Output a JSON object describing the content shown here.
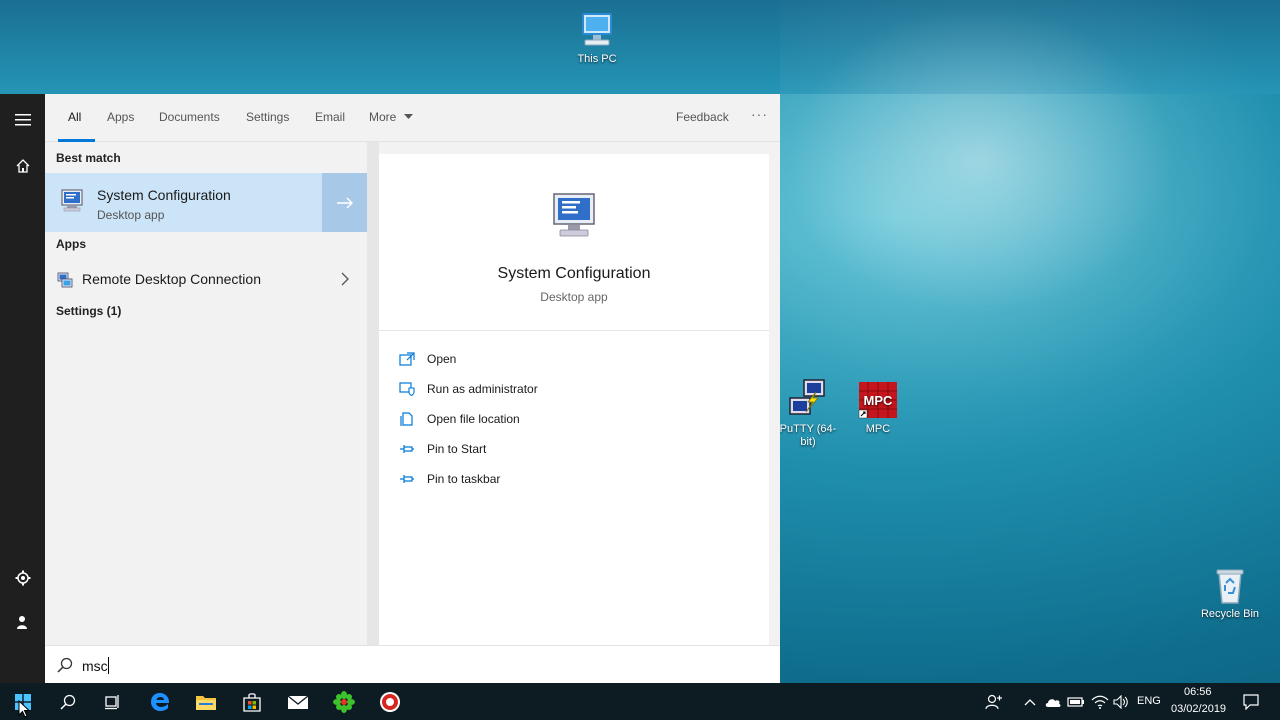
{
  "desktop": {
    "icons": [
      {
        "label": "This PC"
      },
      {
        "label": "PuTTY (64-bit)"
      },
      {
        "label": "MPC"
      },
      {
        "label": "Recycle Bin"
      }
    ],
    "mpc_logo_text": "MPC"
  },
  "search": {
    "tabs": [
      {
        "label": "All",
        "active": true
      },
      {
        "label": "Apps"
      },
      {
        "label": "Documents"
      },
      {
        "label": "Settings"
      },
      {
        "label": "Email"
      },
      {
        "label": "More"
      }
    ],
    "feedback_label": "Feedback",
    "more_options": "···",
    "query": "msc",
    "accent_color": "#0078d7"
  },
  "results": {
    "best_match_heading": "Best match",
    "best_match": {
      "title": "System Configuration",
      "subtitle": "Desktop app"
    },
    "apps_heading": "Apps",
    "apps": [
      {
        "label": "Remote Desktop Connection"
      }
    ],
    "settings_heading": "Settings (1)"
  },
  "detail": {
    "title": "System Configuration",
    "subtitle": "Desktop app",
    "actions": [
      {
        "label": "Open",
        "icon": "open-icon"
      },
      {
        "label": "Run as administrator",
        "icon": "shield-icon"
      },
      {
        "label": "Open file location",
        "icon": "file-location-icon"
      },
      {
        "label": "Pin to Start",
        "icon": "pin-icon"
      },
      {
        "label": "Pin to taskbar",
        "icon": "pin-icon"
      }
    ]
  },
  "taskbar": {
    "language": "ENG",
    "time": "06:56",
    "date": "03/02/2019"
  }
}
